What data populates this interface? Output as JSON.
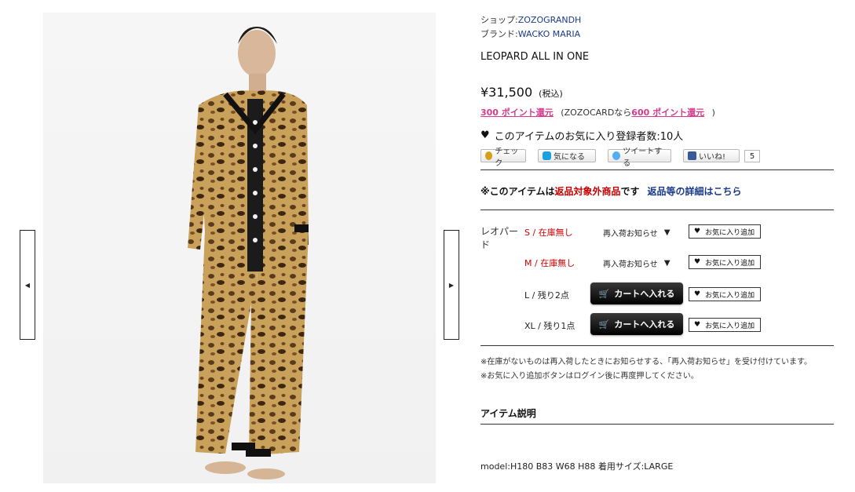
{
  "shop": {
    "label": "ショップ:",
    "name": "ZOZOGRANDH"
  },
  "brand": {
    "label": "ブランド:",
    "name": "WACKO MARIA"
  },
  "product": {
    "title": "LEOPARD ALL IN ONE",
    "price": "¥31,500",
    "tax_note": "(税込)",
    "points_text": "300 ポイント還元",
    "zozocard_prefix": "(ZOZOCARDなら",
    "zozocard_points": "600 ポイント還元",
    "zozocard_suffix": ")",
    "favorite_count_text": "このアイテムのお気に入り登録者数:10人"
  },
  "social": {
    "check": "チェック",
    "kininaru": "気になる",
    "tweet": "ツイートする",
    "like": "いいね!",
    "like_count": "5"
  },
  "returns": {
    "prefix": "※このアイテムは",
    "highlight": "返品対象外商品",
    "suffix": "です",
    "link": "返品等の詳細はこちら"
  },
  "variants": {
    "color_name": "レオパード",
    "restock_label": "再入荷お知らせ",
    "cart_label": "カートへ入れる",
    "favorite_label": "お気に入り追加",
    "sizes": [
      {
        "label": "S / 在庫無し",
        "status": "out"
      },
      {
        "label": "M / 在庫無し",
        "status": "out"
      },
      {
        "label": "L / 残り2点",
        "status": "in"
      },
      {
        "label": "XL / 残り1点",
        "status": "in"
      }
    ]
  },
  "notes": [
    "※在庫がないものは再入荷したときにお知らせする、「再入荷お知らせ」を受け付けています。",
    "※お気に入り追加ボタンはログイン後に再度押してください。"
  ],
  "description": {
    "heading": "アイテム説明",
    "model_info": "model:H180 B83 W68 H88 着用サイズ:LARGE"
  },
  "colors": {
    "link_blue": "#1a3a8a",
    "points_pink": "#d63a8e",
    "alert_red": "#cc0000"
  }
}
